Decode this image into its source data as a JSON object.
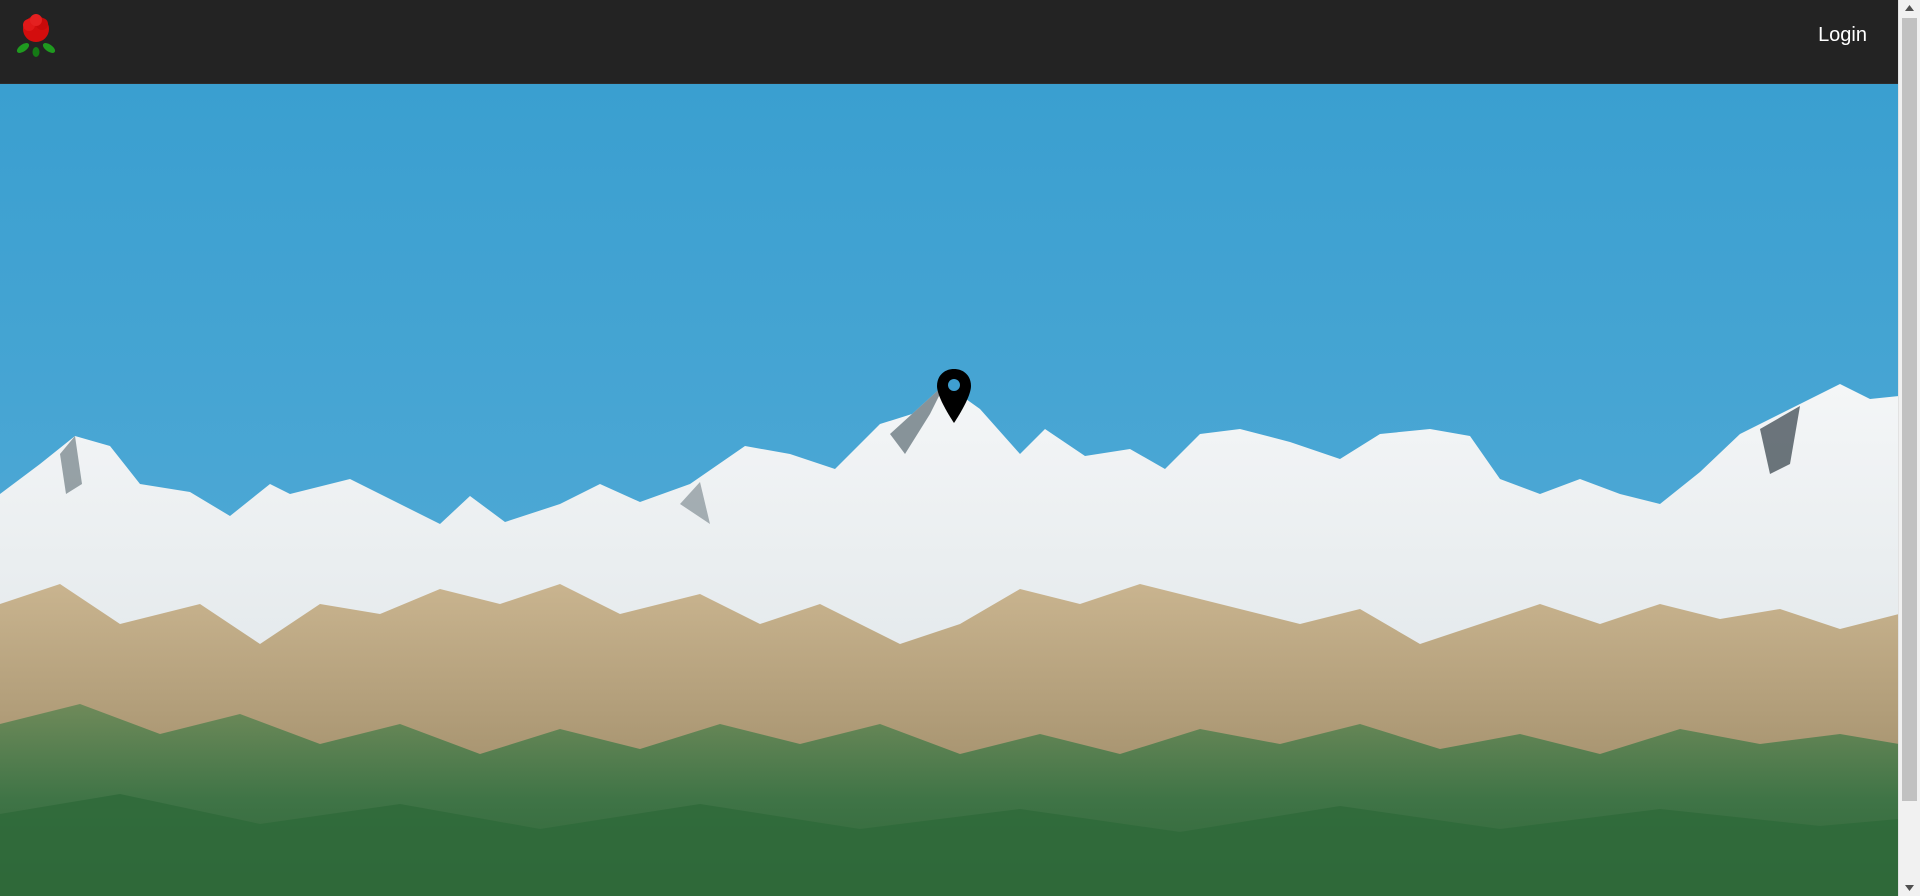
{
  "header": {
    "logo_icon": "rose-logo-icon",
    "login_label": "Login",
    "background": "#232323"
  },
  "scene": {
    "description_icon": "map-pin-icon",
    "sky_color": "#3f9fd0",
    "snow_color": "#eef1f2",
    "forest_color": "#4a7a4c"
  },
  "scrollbar": {
    "up_icon": "scroll-up-arrow-icon",
    "down_icon": "scroll-down-arrow-icon"
  }
}
